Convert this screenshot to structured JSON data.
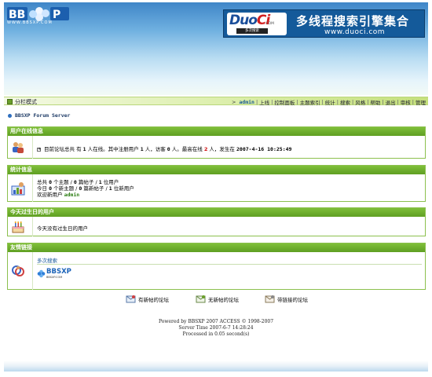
{
  "banner": {
    "logo_text": "WWW.BBSXP.COM",
    "ad": {
      "logo_word_a": "Duo",
      "logo_word_b": "Ci",
      "logo_com": ".COM",
      "logo_sub": "多次搜索",
      "title": "多线程搜索引擎集合",
      "url": "www.duoci.com"
    }
  },
  "nav": {
    "left_label": "分栏模式",
    "arrow": ">",
    "user": "admin",
    "items": [
      "上线",
      "控制面板",
      "主题索引",
      "统计",
      "搜索",
      "风格",
      "帮助",
      "退出",
      "审核",
      "管理"
    ]
  },
  "breadcrumb": "BBSXP Forum Server",
  "online": {
    "title": "用户在线信息",
    "prefix": "目前论坛总共 有 ",
    "total": "1",
    "mid1": " 人在线。其中注册用户 ",
    "registered": "1",
    "mid2": " 人，访客 ",
    "guests": "0",
    "mid3": " 人。最高在线 ",
    "peak": "2",
    "mid4": " 人，发生在 ",
    "peak_time": "2007-4-16 10:25:49"
  },
  "stats": {
    "title": "统计信息",
    "line1": {
      "a": "总共 ",
      "v1": "0",
      "b": " 个主题 / ",
      "v2": "0",
      "c": " 篇帖子 / ",
      "v3": "1",
      "d": " 位用户"
    },
    "line2": {
      "a": "今日 ",
      "v1": "0",
      "b": " 个新主题 / ",
      "v2": "0",
      "c": " 篇新帖子 / ",
      "v3": "1",
      "d": " 位新用户"
    },
    "welcome_label": "欢迎新用户 ",
    "welcome_user": "admin"
  },
  "birthday": {
    "title": "今天过生日的用户",
    "text": "今天没有过生日的用户"
  },
  "links": {
    "title": "友情链接",
    "link_name": "多次搜索",
    "logo_word": "BBSXP",
    "logo_sub": "BBSXP.COM"
  },
  "legend": {
    "new_posts": "有新帖的论坛",
    "no_new_posts": "无新帖的论坛",
    "locked": "带链接的论坛"
  },
  "footer": {
    "line1": "Powered by BBSXP 2007 ACCESS © 1998-2007",
    "line2": "Server Time 2007-6-7 14:28:24",
    "line3": "Processed in 0.05 second(s)"
  },
  "colors": {
    "section_header": "#6aab2c",
    "section_border": "#8cc04e",
    "accent_red": "#d01010",
    "banner_blue": "#3f86c8"
  },
  "icons": [
    "users-online-icon",
    "statistics-icon",
    "birthday-cake-icon",
    "friend-links-icon",
    "forum-new-icon",
    "forum-old-icon",
    "forum-link-icon"
  ]
}
